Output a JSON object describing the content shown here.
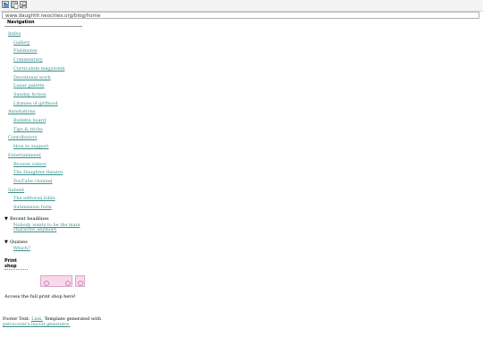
{
  "toolbar": {
    "buttons": [
      {
        "name": "open-icon"
      },
      {
        "name": "copy-icon"
      },
      {
        "name": "print-icon"
      }
    ]
  },
  "address_bar": {
    "url": "www.daughtfr.neocities.org/blog/home"
  },
  "sidebar": {
    "title": "Navigation",
    "items": [
      {
        "label": "Index",
        "level": 0
      },
      {
        "label": "Gallery",
        "level": 1
      },
      {
        "label": "Fieldnotes",
        "level": 1
      },
      {
        "label": "Commentary",
        "level": 1
      },
      {
        "label": "Curriculum megatomb",
        "level": 1
      },
      {
        "label": "Devotional work",
        "level": 1
      },
      {
        "label": "Lunar palette",
        "level": 1
      },
      {
        "label": "Sunday fiction",
        "level": 1
      },
      {
        "label": "Litanies of girlhood",
        "level": 1
      },
      {
        "label": "Annotations",
        "level": 0
      },
      {
        "label": "Bulletin board",
        "level": 1
      },
      {
        "label": "Tips & tricks",
        "level": 1
      },
      {
        "label": "Contributors",
        "level": 0
      },
      {
        "label": "How to support",
        "level": 1
      },
      {
        "label": "Entertainment",
        "level": 0
      },
      {
        "label": "Browse videos",
        "level": 1
      },
      {
        "label": "The Daughter theatre",
        "level": 1
      },
      {
        "label": "YouTube channel",
        "level": 1
      },
      {
        "label": "Submit",
        "level": 0
      },
      {
        "label": "The editorial bible",
        "level": 1
      },
      {
        "label": "Submission form",
        "level": 1
      }
    ],
    "recent": {
      "heading": "Recent headlines",
      "link": "Nobody wants to be the main character anymore"
    },
    "quizzes": {
      "heading": "Quizzes",
      "link": "Which?"
    },
    "print_shop": {
      "title": "Print shop",
      "text": "Access the full print shop here!"
    }
  },
  "footer": {
    "prefix": "Footer Text.",
    "link1": "Link.",
    "middle": "Template generated with",
    "link2": "petracoral's layout generator."
  },
  "colors": {
    "link": "#3a8f8a",
    "banner_bg": "#f8d9ec",
    "banner_border": "#d9a6c8"
  }
}
